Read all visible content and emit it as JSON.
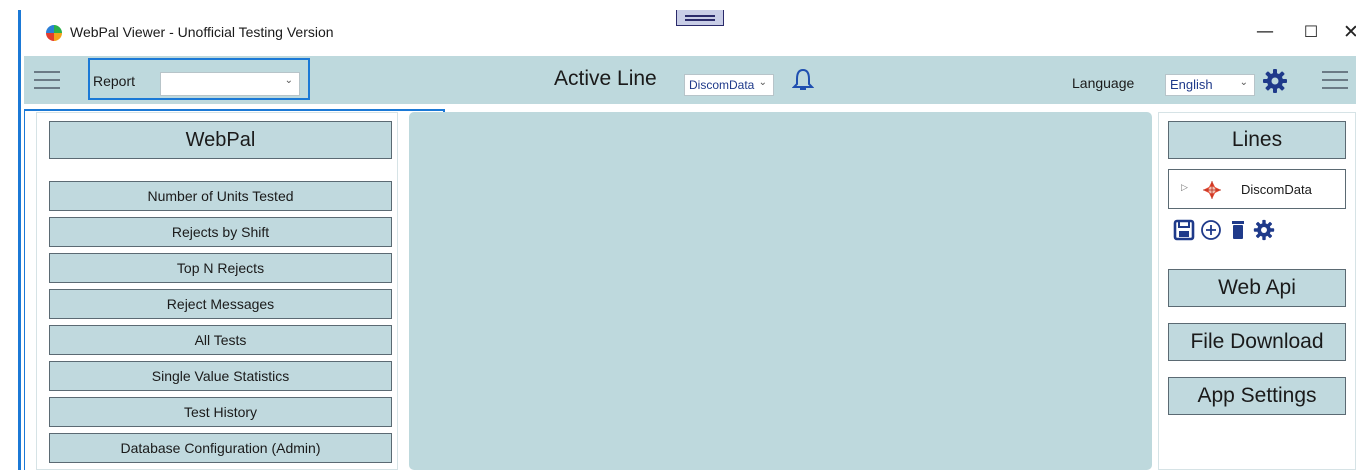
{
  "window": {
    "title": "WebPal Viewer - Unofficial Testing Version",
    "controls": {
      "minimize": "—",
      "maximize": "☐",
      "close": "✕"
    }
  },
  "toolbar": {
    "report_label": "Report",
    "report_selected": "",
    "active_line_label": "Active Line",
    "active_line_selected": "DiscomData",
    "language_label": "Language",
    "language_selected": "English"
  },
  "left_panel": {
    "header": "WebPal",
    "items": [
      "Number of Units Tested",
      "Rejects by Shift",
      "Top N Rejects",
      "Reject Messages",
      "All Tests",
      "Single Value Statistics",
      "Test History",
      "Database Configuration (Admin)"
    ]
  },
  "right_panel": {
    "lines_header": "Lines",
    "tree_item": "DiscomData",
    "tools": [
      "save-icon",
      "add-circle-icon",
      "delete-icon",
      "gear-icon"
    ],
    "buttons": {
      "web_api": "Web Api",
      "file_download": "File Download",
      "app_settings": "App Settings"
    }
  },
  "colors": {
    "accent": "#1b79d6",
    "toolbar_bg": "#bed9dd",
    "button_bg": "#c0d9de",
    "icon_blue": "#1f3a8a"
  }
}
